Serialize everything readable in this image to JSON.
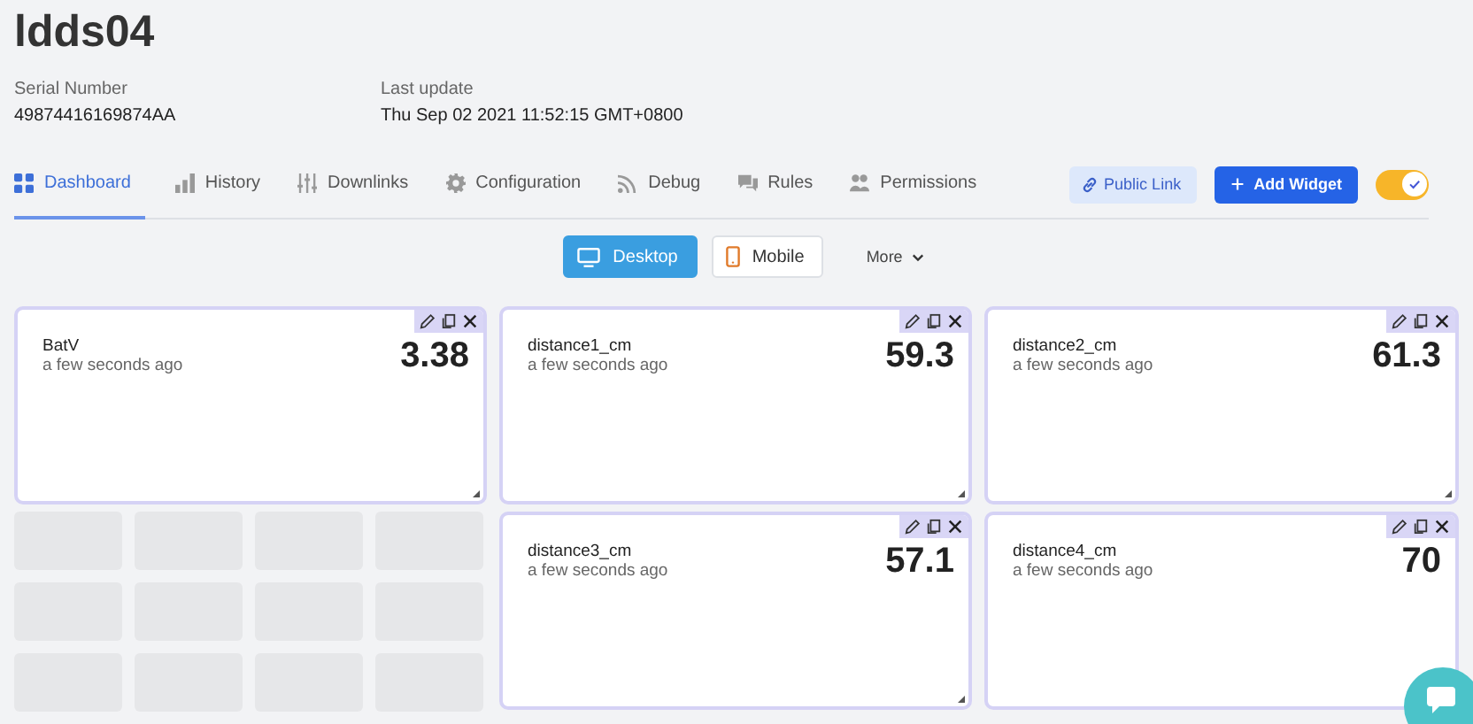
{
  "device": {
    "title": "ldds04",
    "fields": [
      {
        "label": "Serial Number",
        "value": "49874416169874AA"
      },
      {
        "label": "Last update",
        "value": "Thu Sep 02 2021 11:52:15 GMT+0800"
      }
    ]
  },
  "tabs": [
    {
      "label": "Dashboard",
      "kind": "grid",
      "selected": true
    },
    {
      "label": "History",
      "kind": "bars",
      "selected": false
    },
    {
      "label": "Downlinks",
      "kind": "sliders",
      "selected": false
    },
    {
      "label": "Configuration",
      "kind": "gear",
      "selected": false
    },
    {
      "label": "Debug",
      "kind": "rss",
      "selected": false
    },
    {
      "label": "Rules",
      "kind": "chat",
      "selected": false
    },
    {
      "label": "Permissions",
      "kind": "people",
      "selected": false
    }
  ],
  "actions": {
    "public_link": "Public Link",
    "add_widget": "Add Widget",
    "toggle_on": true
  },
  "views": [
    {
      "label": "Desktop",
      "kind": "monitor",
      "selected": true
    },
    {
      "label": "Mobile",
      "kind": "phone",
      "selected": false
    }
  ],
  "more": "More",
  "widgets": [
    {
      "name": "BatV",
      "time": "a few seconds ago",
      "value": "3.38"
    },
    {
      "name": "distance1_cm",
      "time": "a few seconds ago",
      "value": "59.3"
    },
    {
      "name": "distance2_cm",
      "time": "a few seconds ago",
      "value": "61.3"
    },
    {
      "name": "distance3_cm",
      "time": "a few seconds ago",
      "value": "57.1"
    },
    {
      "name": "distance4_cm",
      "time": "a few seconds ago",
      "value": "70"
    }
  ]
}
